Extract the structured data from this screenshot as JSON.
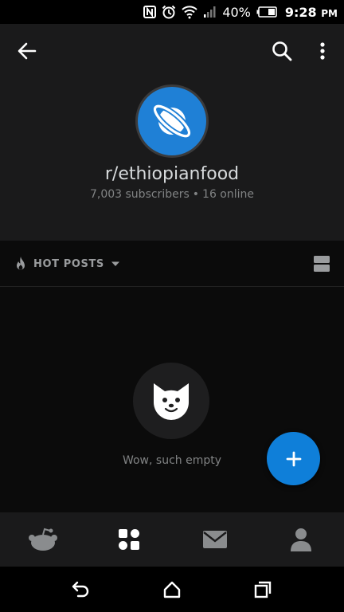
{
  "status_bar": {
    "battery_percent": "40%",
    "time": "9:28",
    "time_suffix": "PM",
    "icons": [
      "nfc-icon",
      "alarm-icon",
      "wifi-icon",
      "signal-icon",
      "battery-icon"
    ]
  },
  "header": {
    "back_icon": "arrow-left-icon",
    "search_icon": "search-icon",
    "more_icon": "more-vertical-icon",
    "community_icon": "planet-icon",
    "subreddit_name": "r/ethiopianfood",
    "subscribers": "7,003 subscribers",
    "separator": "•",
    "online": "16 online"
  },
  "sort_bar": {
    "sort_icon": "flame-icon",
    "sort_label": "HOT POSTS",
    "dropdown_icon": "caret-down-icon",
    "view_icon": "card-view-icon"
  },
  "empty_state": {
    "art_icon": "doge-icon",
    "message": "Wow, such empty"
  },
  "fab": {
    "icon": "plus-icon"
  },
  "bottom_nav": {
    "items": [
      {
        "name": "home",
        "icon": "reddit-snoo-icon"
      },
      {
        "name": "communities",
        "icon": "grid-icon"
      },
      {
        "name": "inbox",
        "icon": "mail-icon"
      },
      {
        "name": "profile",
        "icon": "user-icon"
      }
    ]
  },
  "android_nav": {
    "icons": [
      "back-icon",
      "home-icon",
      "recents-icon"
    ]
  },
  "colors": {
    "accent": "#0f7fd9",
    "community_icon_bg": "#1f80d6",
    "header_bg": "#1a1a1b",
    "page_bg": "#0b0b0b",
    "primary_text": "#d7dadc",
    "secondary_text": "#818384"
  }
}
